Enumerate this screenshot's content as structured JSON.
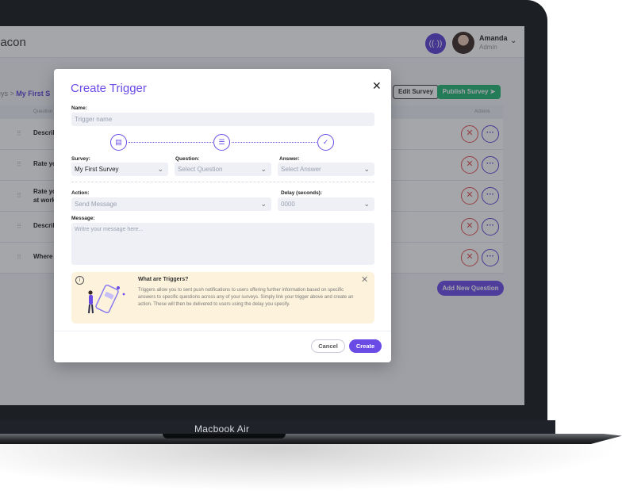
{
  "device": {
    "label": "Macbook Air"
  },
  "app": {
    "brand": "eacon",
    "user": {
      "name": "Amanda",
      "role": "Admin"
    },
    "breadcrumb": {
      "prefix": "eys >",
      "current": "My First S"
    },
    "buttons": {
      "edit": "Edit Survey",
      "publish": "Publish Survey",
      "add_question": "Add New Question"
    },
    "table": {
      "headers": {
        "question": "Question",
        "actions": "Actions"
      },
      "rows": [
        {
          "text": "Describ"
        },
        {
          "text": "Rate yo"
        },
        {
          "text": "Rate yo at work"
        },
        {
          "text": "Describ"
        },
        {
          "text": "Where"
        }
      ]
    }
  },
  "modal": {
    "title": "Create Trigger",
    "name": {
      "label": "Name:",
      "placeholder": "Trigger name"
    },
    "survey": {
      "label": "Survey:",
      "value": "My First Survey"
    },
    "question": {
      "label": "Question:",
      "placeholder": "Select Question"
    },
    "answer": {
      "label": "Answer:",
      "placeholder": "Select Answer"
    },
    "action": {
      "label": "Action:",
      "placeholder": "Send Message"
    },
    "delay": {
      "label": "Delay (seconds):",
      "placeholder": "0000"
    },
    "message": {
      "label": "Message:",
      "placeholder": "Writre your message here..."
    },
    "info": {
      "heading": "What are Triggers?",
      "body": "Triggers allow you to sent push notifications to users offering further information based on specific answers to specific questions across any of your surveys. Simply link your trigger above and create an action. These will then be delivered to users using the delay you specify."
    },
    "cancel_label": "Cancel",
    "create_label": "Create"
  },
  "colors": {
    "accent": "#6a4be6",
    "success": "#22b573",
    "danger": "#e24b4b",
    "info_bg": "#fdf3dc"
  }
}
